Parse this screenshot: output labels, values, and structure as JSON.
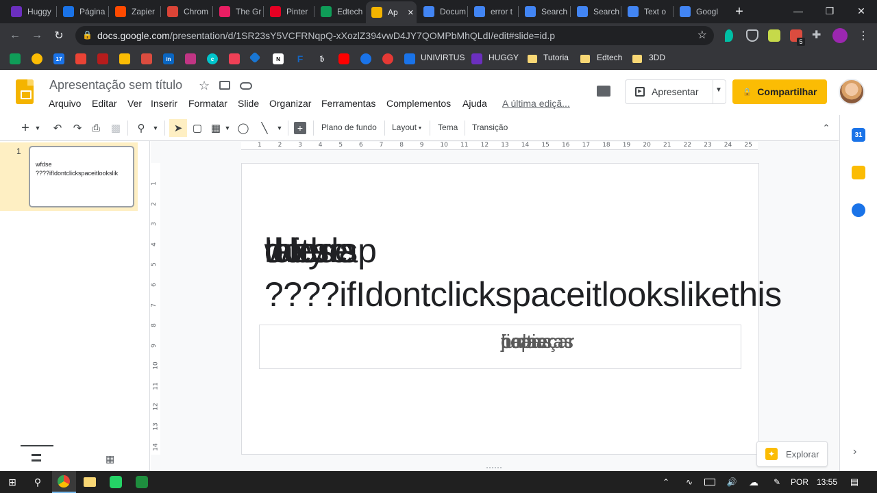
{
  "browser": {
    "tabs": [
      {
        "label": "Huggy",
        "color": "#6b2fbf"
      },
      {
        "label": "Página",
        "color": "#1a73e8"
      },
      {
        "label": "Zapier",
        "color": "#ff4a00"
      },
      {
        "label": "Chrom",
        "color": "#db4437"
      },
      {
        "label": "The Gr",
        "color": "#e91e63"
      },
      {
        "label": "Pinter",
        "color": "#e60023"
      },
      {
        "label": "Edtech",
        "color": "#0f9d58"
      },
      {
        "label": "Ap",
        "color": "#f4b400"
      },
      {
        "label": "Docum",
        "color": "#4285f4"
      },
      {
        "label": "error t",
        "color": "#4285f4"
      },
      {
        "label": "Search",
        "color": "#4285f4"
      },
      {
        "label": "Search",
        "color": "#4285f4"
      },
      {
        "label": "Text o",
        "color": "#4285f4"
      },
      {
        "label": "Googl",
        "color": "#4285f4"
      }
    ],
    "new_tab_label": "+",
    "url_host": "docs.google.com",
    "url_path": "/presentation/d/1SR23sY5VCFRNqpQ-xXozlZ394vwD4JY7QOMPbMhQLdI/edit#slide=id.p",
    "extension_badge": "5"
  },
  "bookmarks": [
    {
      "label": "UNIVIRTUS",
      "color": "#1a73e8"
    },
    {
      "label": "HUGGY",
      "color": "#6b2fbf"
    },
    {
      "label": "Tutoria",
      "color": "#f8d775"
    },
    {
      "label": "Edtech",
      "color": "#f8d775"
    },
    {
      "label": "3DD",
      "color": "#f8d775"
    }
  ],
  "bookmark_badge": "17",
  "app": {
    "title": "Apresentação sem título",
    "menu": [
      "Arquivo",
      "Editar",
      "Ver",
      "Inserir",
      "Formatar",
      "Slide",
      "Organizar",
      "Ferramentas",
      "Complementos",
      "Ajuda"
    ],
    "last_edit": "A última ediçã...",
    "present_label": "Apresentar",
    "share_label": "Compartilhar"
  },
  "toolbar": {
    "background": "Plano de fundo",
    "layout": "Layout",
    "theme": "Tema",
    "transition": "Transição"
  },
  "filmstrip": {
    "slide_number": "1",
    "thumb_line1": "wfdse",
    "thumb_line2": "????ifIdontclickspaceitlookslik"
  },
  "ruler": {
    "h_ticks": [
      "1",
      "2",
      "3",
      "4",
      "5",
      "6",
      "7",
      "8",
      "9",
      "10",
      "11",
      "12",
      "13",
      "14",
      "15",
      "16",
      "17",
      "18",
      "19",
      "20",
      "21",
      "22",
      "23",
      "24",
      "25"
    ],
    "v_ticks": [
      "1",
      "2",
      "3",
      "4",
      "5",
      "6",
      "7",
      "8",
      "9",
      "10",
      "11",
      "12",
      "13",
      "14"
    ]
  },
  "slide": {
    "title_overlap": [
      "why",
      "do",
      "these",
      "letters",
      "overlap",
      "wfdse"
    ],
    "title_line2": "????ifIdontclickspaceitlookslikethis",
    "subtitle_overlap": [
      "palavras",
      "ficam",
      "juntas",
      "começar",
      "copiar",
      "pular"
    ]
  },
  "side_panel": {
    "calendar_label": "31",
    "explore_label": "Explorar"
  },
  "taskbar": {
    "language": "POR",
    "time": "13:55"
  }
}
